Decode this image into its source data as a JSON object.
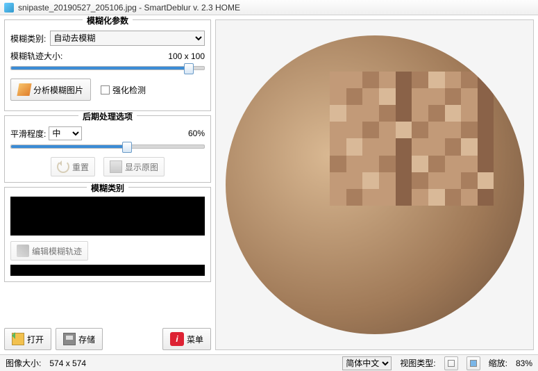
{
  "title": "snipaste_20190527_205106.jpg - SmartDeblur v. 2.3 HOME",
  "panel1": {
    "legend": "模糊化参数",
    "blur_type_label": "模糊类别:",
    "blur_type_value": "自动去模糊",
    "trace_size_label": "模糊轨迹大小:",
    "trace_size_value": "100 x 100",
    "trace_slider_pct": 92,
    "analyze_btn": "分析模糊图片",
    "aggressive_label": "强化检测"
  },
  "panel2": {
    "legend": "后期处理选项",
    "smooth_label": "平滑程度:",
    "smooth_value": "中",
    "smooth_pct_text": "60%",
    "smooth_slider_pct": 60,
    "reset_btn": "重置",
    "show_orig_btn": "显示原图"
  },
  "panel3": {
    "legend": "模糊类别",
    "edit_kernel_btn": "编辑模糊轨迹"
  },
  "bottom": {
    "open": "打开",
    "save": "存储",
    "menu": "菜单",
    "menu_icon_text": "i"
  },
  "status": {
    "img_size_label": "图像大小:",
    "img_size_value": "574 x 574",
    "lang_value": "简体中文",
    "view_type_label": "视图类型:",
    "zoom_label": "缩放:",
    "zoom_value": "83%"
  }
}
